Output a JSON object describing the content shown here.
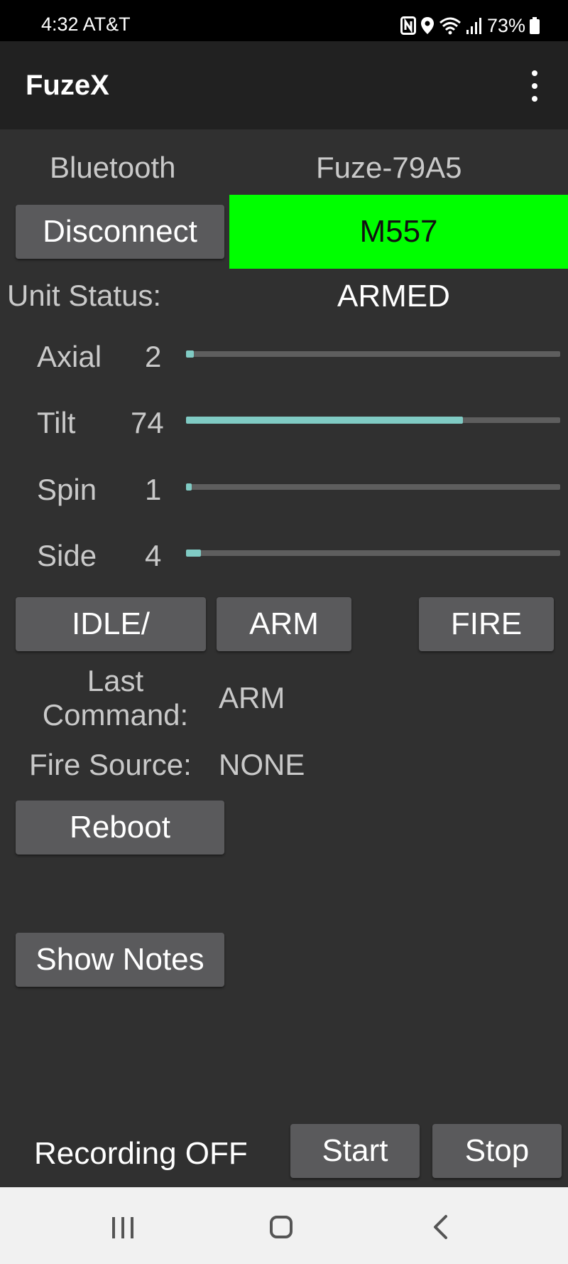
{
  "status_bar": {
    "time": "4:32",
    "carrier": "AT&T",
    "battery": "73%",
    "icons": [
      "nfc-icon",
      "location-icon",
      "wifi-icon",
      "signal-icon",
      "battery-icon"
    ]
  },
  "app_bar": {
    "title": "FuzeX",
    "menu_icon": "more-vert-icon"
  },
  "connection": {
    "type_label": "Bluetooth",
    "device_name": "Fuze-79A5",
    "disconnect_label": "Disconnect",
    "model": "M557",
    "model_color": "#00ff00"
  },
  "unit_status": {
    "label": "Unit Status:",
    "value": "ARMED"
  },
  "sensors": {
    "accent_color": "#80cbc4",
    "items": [
      {
        "label": "Axial",
        "value": "2",
        "level": 0.02
      },
      {
        "label": "Tilt",
        "value": "74",
        "level": 0.74
      },
      {
        "label": "Spin",
        "value": "1",
        "level": 0.01
      },
      {
        "label": "Side",
        "value": "4",
        "level": 0.04
      }
    ]
  },
  "commands": {
    "idle_label": "IDLE/",
    "arm_label": "ARM",
    "fire_label": "FIRE"
  },
  "last_command": {
    "label_line1": "Last",
    "label_line2": "Command:",
    "value": "ARM"
  },
  "fire_source": {
    "label": "Fire Source:",
    "value": "NONE"
  },
  "reboot_label": "Reboot",
  "notes_label": "Show Notes",
  "recording": {
    "status": "Recording OFF",
    "start_label": "Start",
    "stop_label": "Stop"
  },
  "nav_bar": {
    "icons": [
      "recents-icon",
      "home-icon",
      "back-icon"
    ]
  }
}
